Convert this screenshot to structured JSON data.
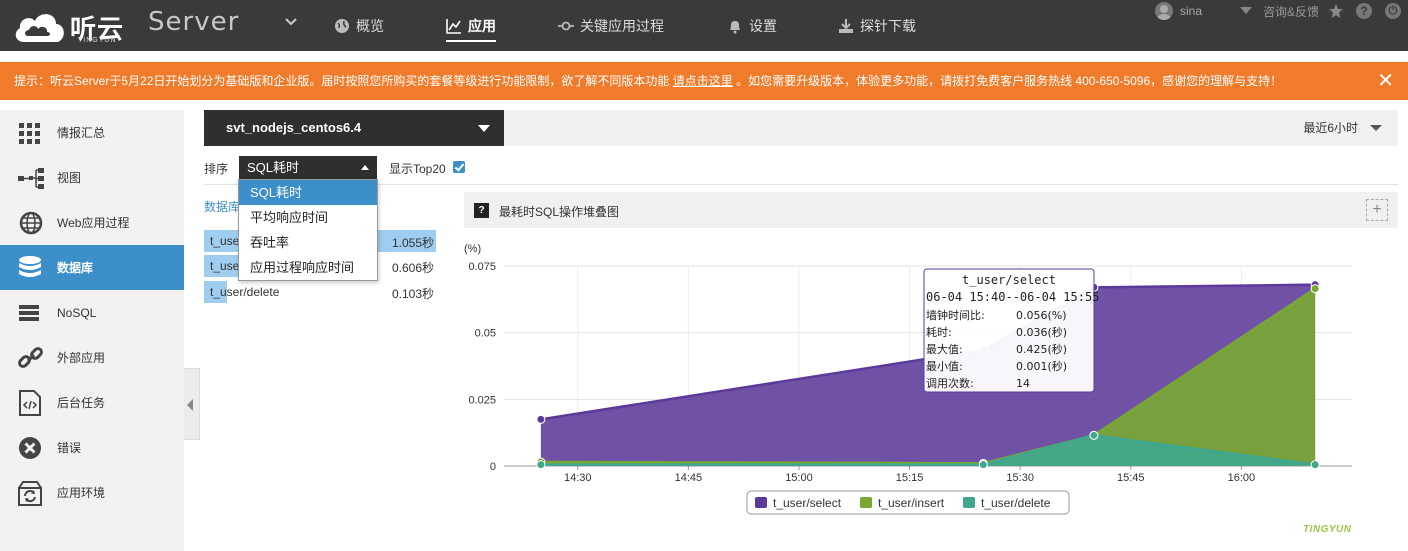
{
  "header": {
    "logo_text": "听云",
    "logo_sub": "TINGYUN",
    "product": "Server",
    "nav": [
      {
        "label": "概览",
        "icon": "globe-icon",
        "active": false
      },
      {
        "label": "应用",
        "icon": "chart-line-icon",
        "active": true
      },
      {
        "label": "关键应用过程",
        "icon": "process-icon",
        "active": false
      },
      {
        "label": "设置",
        "icon": "bell-icon",
        "active": false
      },
      {
        "label": "探针下载",
        "icon": "download-icon",
        "active": false
      }
    ],
    "user": "sina",
    "feedback": "咨询&反馈",
    "help_icon": "?",
    "power_icon": "⏻"
  },
  "notice": {
    "prefix": "提示：听云Server于5月22日开始划分为基础版和企业版。届时按照您所购买的套餐等级进行功能限制，欲了解不同版本功能 ",
    "link": "请点击这里",
    "suffix": " 。如您需要升级版本，体验更多功能，请拨打免费客户服务热线 400-650-5096，感谢您的理解与支持！",
    "close": "✕"
  },
  "sidebar": {
    "items": [
      {
        "label": "情报汇总",
        "icon": "grid-icon",
        "active": false
      },
      {
        "label": "视图",
        "icon": "topology-icon",
        "active": false
      },
      {
        "label": "Web应用过程",
        "icon": "web-globe-icon",
        "active": false
      },
      {
        "label": "数据库",
        "icon": "database-icon",
        "active": true
      },
      {
        "label": "NoSQL",
        "icon": "nosql-icon",
        "active": false
      },
      {
        "label": "外部应用",
        "icon": "link-icon",
        "active": false
      },
      {
        "label": "后台任务",
        "icon": "code-file-icon",
        "active": false
      },
      {
        "label": "错误",
        "icon": "error-icon",
        "active": false
      },
      {
        "label": "应用环境",
        "icon": "refresh-box-icon",
        "active": false
      }
    ]
  },
  "appbar": {
    "app_name": "svt_nodejs_centos6.4",
    "time_range": "最近6小时"
  },
  "sort": {
    "label": "排序",
    "selected": "SQL耗时",
    "options": [
      "SQL耗时",
      "平均响应时间",
      "吞吐率",
      "应用过程响应时间"
    ],
    "top20_label": "显示Top20",
    "top20_checked": true
  },
  "db_list": {
    "header": "数据库",
    "rows": [
      {
        "name": "t_user/select",
        "value": "1.055秒",
        "fraction": 1.0
      },
      {
        "name": "t_user/insert",
        "value": "0.606秒",
        "fraction": 0.574
      },
      {
        "name": "t_user/delete",
        "value": "0.103秒",
        "fraction": 0.098
      }
    ]
  },
  "chart_panel": {
    "title": "最耗时SQL操作堆叠图",
    "help": "?",
    "expand": "+"
  },
  "tooltip": {
    "title": "t_user/select",
    "range": "06-04 15:40--06-04 15:55",
    "rows": [
      {
        "k": "墙钟时间比:",
        "v": "0.056(%)"
      },
      {
        "k": "耗时:",
        "v": "0.036(秒)"
      },
      {
        "k": "最大值:",
        "v": "0.425(秒)"
      },
      {
        "k": "最小值:",
        "v": "0.001(秒)"
      },
      {
        "k": "调用次数:",
        "v": "14"
      }
    ]
  },
  "chart_data": {
    "type": "area",
    "title": "最耗时SQL操作堆叠图",
    "ylabel": "(%)",
    "xlabel": "",
    "ylim": [
      0,
      0.075
    ],
    "yticks": [
      "0",
      "0.025",
      "0.05",
      "0.075"
    ],
    "xticks": [
      "14:30",
      "14:45",
      "15:00",
      "15:15",
      "15:30",
      "15:45",
      "16:00"
    ],
    "x": [
      "14:25",
      "15:25",
      "15:40",
      "16:10"
    ],
    "stacked": false,
    "series": [
      {
        "name": "t_user/select",
        "color": "#5b3a9a",
        "values": [
          0.0175,
          0.0435,
          0.067,
          0.068
        ]
      },
      {
        "name": "t_user/insert",
        "color": "#79a832",
        "values": [
          0.0015,
          0.001,
          0.0115,
          0.0665
        ]
      },
      {
        "name": "t_user/delete",
        "color": "#3fa78e",
        "values": [
          0.0005,
          0.0005,
          0.0115,
          0.0005
        ]
      }
    ],
    "legend": "bottom-center",
    "grid": true
  },
  "footer": {
    "brand": "TINGYUN"
  }
}
